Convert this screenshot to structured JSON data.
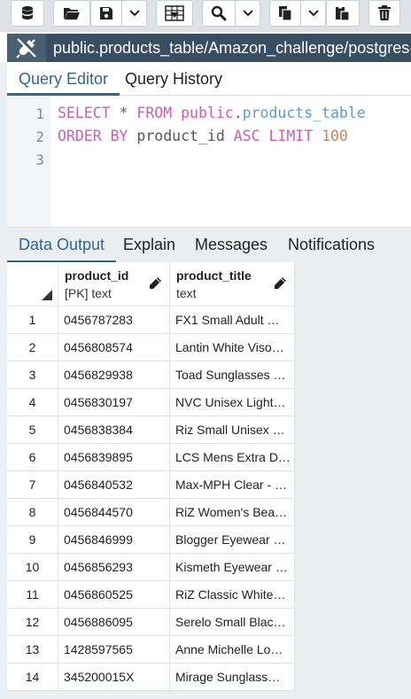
{
  "toolbar": {
    "buttons": [
      {
        "name": "database-icon"
      },
      {
        "name": "open-file-icon"
      },
      {
        "name": "save-icon"
      },
      {
        "name": "save-dropdown-icon"
      },
      {
        "name": "save-data-changes-icon"
      },
      {
        "name": "find-icon"
      },
      {
        "name": "find-dropdown-icon"
      },
      {
        "name": "copy-icon"
      },
      {
        "name": "copy-dropdown-icon"
      },
      {
        "name": "paste-icon"
      },
      {
        "name": "delete-icon"
      }
    ]
  },
  "connection": {
    "label": "public.products_table/Amazon_challenge/postgres@"
  },
  "editor_tabs": [
    {
      "label": "Query Editor",
      "active": true
    },
    {
      "label": "Query History",
      "active": false
    }
  ],
  "editor": {
    "line_numbers": [
      "1",
      "2",
      "3"
    ],
    "line1": {
      "kw1": "SELECT",
      "star": "*",
      "kw2": "FROM",
      "schema": "public",
      "dot": ".",
      "table": "products_table"
    },
    "line2": {
      "kw1": "ORDER BY",
      "col": "product_id",
      "kw2": "ASC",
      "kw3": "LIMIT",
      "num": "100"
    }
  },
  "output_tabs": [
    {
      "label": "Data Output",
      "active": true
    },
    {
      "label": "Explain",
      "active": false
    },
    {
      "label": "Messages",
      "active": false
    },
    {
      "label": "Notifications",
      "active": false
    }
  ],
  "grid": {
    "columns": [
      {
        "name": "product_id",
        "type": "[PK] text"
      },
      {
        "name": "product_title",
        "type": "text"
      }
    ],
    "rows": [
      {
        "n": "1",
        "id": "0456787283",
        "title": "FX1 Small Adult …"
      },
      {
        "n": "2",
        "id": "0456808574",
        "title": "Lantin White Viso…"
      },
      {
        "n": "3",
        "id": "0456829938",
        "title": "Toad Sunglasses …"
      },
      {
        "n": "4",
        "id": "0456830197",
        "title": "NVC Unisex Light…"
      },
      {
        "n": "5",
        "id": "0456838384",
        "title": "Riz Small Unisex …"
      },
      {
        "n": "6",
        "id": "0456839895",
        "title": "LCS Mens Extra D…"
      },
      {
        "n": "7",
        "id": "0456840532",
        "title": "Max-MPH Clear - …"
      },
      {
        "n": "8",
        "id": "0456844570",
        "title": "RiZ Women's Bea…"
      },
      {
        "n": "9",
        "id": "0456846999",
        "title": "Blogger Eyewear …"
      },
      {
        "n": "10",
        "id": "0456856293",
        "title": "Kismeth Eyewear …"
      },
      {
        "n": "11",
        "id": "0456860525",
        "title": "RiZ Classic White…"
      },
      {
        "n": "12",
        "id": "0456886095",
        "title": "Serelo Small Blac…"
      },
      {
        "n": "13",
        "id": "1428597565",
        "title": "Anne Michelle Lo…"
      },
      {
        "n": "14",
        "id": "345200015X",
        "title": "Mirage Sunglass…"
      }
    ]
  },
  "colors": {
    "accent": "#326690",
    "connection_bar": "#3a4e62",
    "keyword": "#c85fb7",
    "table_name": "#5a9bd6",
    "number": "#c9835a"
  }
}
